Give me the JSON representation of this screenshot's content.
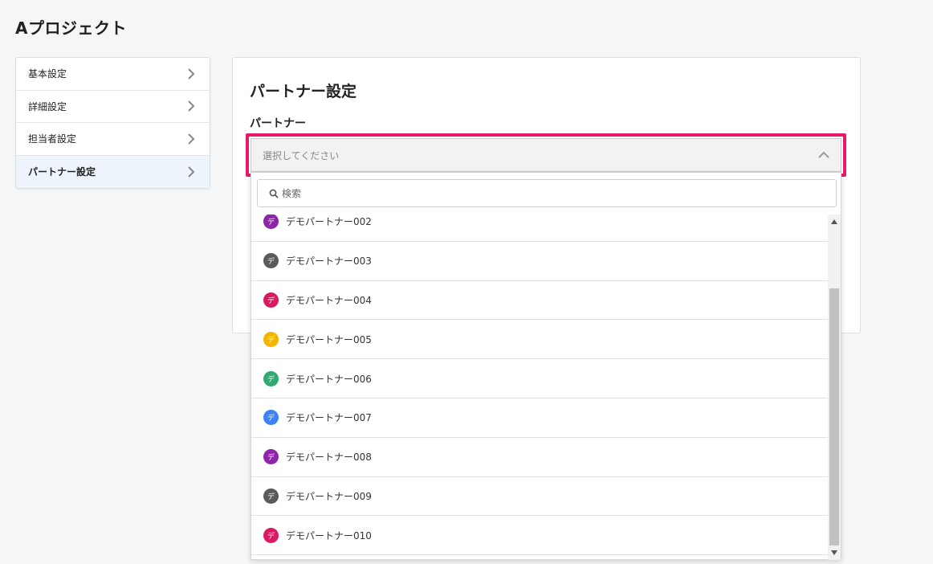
{
  "project_title": "Aプロジェクト",
  "sidebar": {
    "items": [
      {
        "label": "基本設定"
      },
      {
        "label": "詳細設定"
      },
      {
        "label": "担当者設定"
      },
      {
        "label": "パートナー設定",
        "active": true
      }
    ]
  },
  "main": {
    "title": "パートナー設定",
    "field_label": "パートナー",
    "select_placeholder": "選択してください",
    "search_placeholder": "検索"
  },
  "partners": [
    {
      "name": "デモパートナー002",
      "avatar": "デ",
      "color": "#8e24aa"
    },
    {
      "name": "デモパートナー003",
      "avatar": "デ",
      "color": "#5a5a5a"
    },
    {
      "name": "デモパートナー004",
      "avatar": "デ",
      "color": "#d81b60"
    },
    {
      "name": "デモパートナー005",
      "avatar": "デ",
      "color": "#f4b400"
    },
    {
      "name": "デモパートナー006",
      "avatar": "デ",
      "color": "#2eaa6e"
    },
    {
      "name": "デモパートナー007",
      "avatar": "デ",
      "color": "#3b82f6"
    },
    {
      "name": "デモパートナー008",
      "avatar": "デ",
      "color": "#8e24aa"
    },
    {
      "name": "デモパートナー009",
      "avatar": "デ",
      "color": "#5a5a5a"
    },
    {
      "name": "デモパートナー010",
      "avatar": "デ",
      "color": "#d81b60"
    }
  ],
  "colors": {
    "highlight": "#e8196b",
    "active_bg": "#eef4fb"
  },
  "icons": {
    "chevron": "chevron-right-icon",
    "caret": "chevron-up-icon",
    "search": "search-icon"
  }
}
